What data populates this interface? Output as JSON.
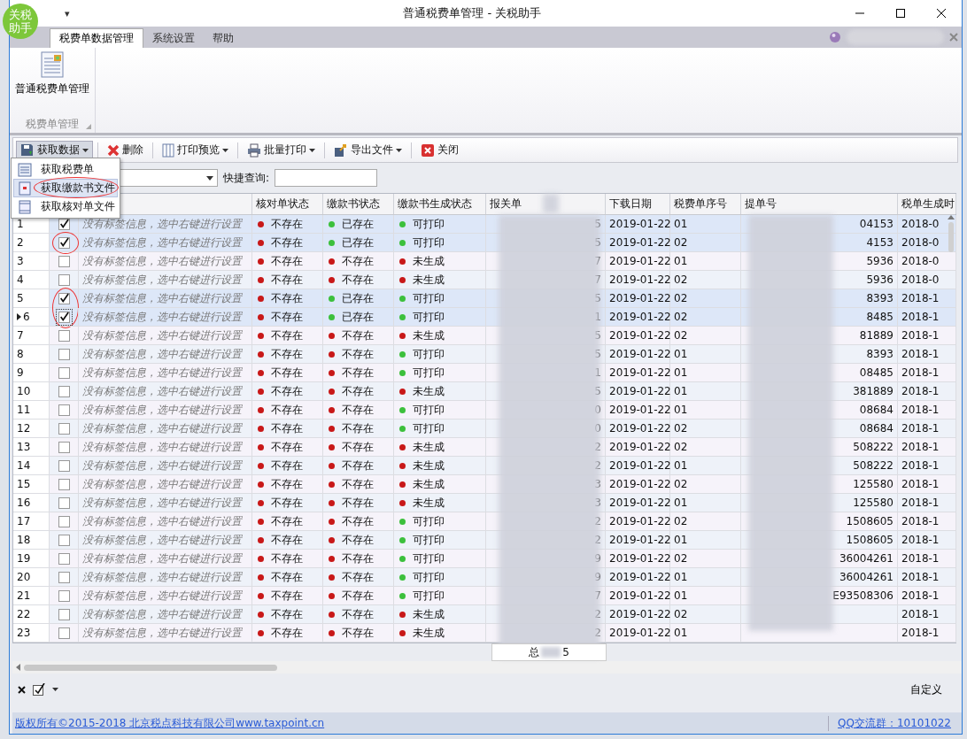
{
  "window": {
    "logo": [
      "关税",
      "助手"
    ],
    "quick_access": "▾",
    "title": "普通税费单管理 - 关税助手"
  },
  "ribbon": {
    "tabs": [
      {
        "label": "税费单数据管理",
        "selected": true
      },
      {
        "label": "系统设置",
        "selected": false
      },
      {
        "label": "帮助",
        "selected": false
      }
    ],
    "big_button": "普通税费单管理",
    "group_label": "税费单管理"
  },
  "toolbar": [
    {
      "kind": "get",
      "label": "获取数据",
      "menu": true,
      "pressed": true
    },
    {
      "kind": "delete",
      "label": "删除",
      "menu": false,
      "pressed": false
    },
    {
      "kind": "preview",
      "label": "打印预览",
      "menu": true,
      "pressed": false
    },
    {
      "kind": "print",
      "label": "批量打印",
      "menu": true,
      "pressed": false
    },
    {
      "kind": "export",
      "label": "导出文件",
      "menu": true,
      "pressed": false
    },
    {
      "kind": "close",
      "label": "关闭",
      "menu": false,
      "pressed": false
    }
  ],
  "dropdown": [
    {
      "kind": "list",
      "label": "获取税费单",
      "selected": false,
      "circled": false
    },
    {
      "kind": "doc",
      "label": "获取缴款书文件",
      "selected": true,
      "circled": true
    },
    {
      "kind": "form",
      "label": "获取核对单文件",
      "selected": false,
      "circled": false
    }
  ],
  "quick_search": {
    "label": "快捷查询:"
  },
  "table": {
    "columns": [
      "核对单状态",
      "缴款书状态",
      "缴款书生成状态",
      "报关单",
      "下载日期",
      "税费单序号",
      "提单号",
      "税单生成时"
    ],
    "rows": [
      {
        "no": "1",
        "checked": true,
        "circled": false,
        "current": false,
        "label": "没有标签信息，选中右键进行设置",
        "verify": {
          "text": "不存在",
          "ok": false
        },
        "payment": {
          "text": "已存在",
          "ok": true
        },
        "gen": {
          "text": "可打印",
          "ok": true
        },
        "customs": "5",
        "date": "2019-01-22",
        "seq": "01",
        "bill": "04153",
        "time": "2018-0"
      },
      {
        "no": "2",
        "checked": true,
        "circled": true,
        "current": false,
        "label": "没有标签信息，选中右键进行设置",
        "verify": {
          "text": "不存在",
          "ok": false
        },
        "payment": {
          "text": "已存在",
          "ok": true
        },
        "gen": {
          "text": "可打印",
          "ok": true
        },
        "customs": "5",
        "date": "2019-01-22",
        "seq": "02",
        "bill": "4153",
        "time": "2018-0"
      },
      {
        "no": "3",
        "checked": false,
        "circled": false,
        "current": false,
        "label": "没有标签信息，选中右键进行设置",
        "verify": {
          "text": "不存在",
          "ok": false
        },
        "payment": {
          "text": "不存在",
          "ok": false
        },
        "gen": {
          "text": "未生成",
          "ok": false
        },
        "customs": "7",
        "date": "2019-01-22",
        "seq": "01",
        "bill": "5936",
        "time": "2018-0"
      },
      {
        "no": "4",
        "checked": false,
        "circled": false,
        "current": false,
        "label": "没有标签信息，选中右键进行设置",
        "verify": {
          "text": "不存在",
          "ok": false
        },
        "payment": {
          "text": "不存在",
          "ok": false
        },
        "gen": {
          "text": "未生成",
          "ok": false
        },
        "customs": "7",
        "date": "2019-01-22",
        "seq": "02",
        "bill": "5936",
        "time": "2018-0"
      },
      {
        "no": "5",
        "checked": true,
        "circled": true,
        "current": false,
        "label": "没有标签信息，选中右键进行设置",
        "verify": {
          "text": "不存在",
          "ok": false
        },
        "payment": {
          "text": "已存在",
          "ok": true
        },
        "gen": {
          "text": "可打印",
          "ok": true
        },
        "customs": "5",
        "date": "2019-01-22",
        "seq": "02",
        "bill": "8393",
        "time": "2018-1"
      },
      {
        "no": "6",
        "checked": true,
        "circled": true,
        "current": true,
        "label": "没有标签信息，选中右键进行设置",
        "verify": {
          "text": "不存在",
          "ok": false
        },
        "payment": {
          "text": "已存在",
          "ok": true
        },
        "gen": {
          "text": "可打印",
          "ok": true
        },
        "customs": "1",
        "date": "2019-01-22",
        "seq": "02",
        "bill": "8485",
        "time": "2018-1"
      },
      {
        "no": "7",
        "checked": false,
        "circled": false,
        "current": false,
        "label": "没有标签信息，选中右键进行设置",
        "verify": {
          "text": "不存在",
          "ok": false
        },
        "payment": {
          "text": "不存在",
          "ok": false
        },
        "gen": {
          "text": "未生成",
          "ok": false
        },
        "customs": "5",
        "date": "2019-01-22",
        "seq": "02",
        "bill": "81889",
        "time": "2018-1"
      },
      {
        "no": "8",
        "checked": false,
        "circled": false,
        "current": false,
        "label": "没有标签信息，选中右键进行设置",
        "verify": {
          "text": "不存在",
          "ok": false
        },
        "payment": {
          "text": "不存在",
          "ok": false
        },
        "gen": {
          "text": "可打印",
          "ok": true
        },
        "customs": "5",
        "date": "2019-01-22",
        "seq": "01",
        "bill": "8393",
        "time": "2018-1"
      },
      {
        "no": "9",
        "checked": false,
        "circled": false,
        "current": false,
        "label": "没有标签信息，选中右键进行设置",
        "verify": {
          "text": "不存在",
          "ok": false
        },
        "payment": {
          "text": "不存在",
          "ok": false
        },
        "gen": {
          "text": "可打印",
          "ok": true
        },
        "customs": "1",
        "date": "2019-01-22",
        "seq": "01",
        "bill": "08485",
        "time": "2018-1"
      },
      {
        "no": "10",
        "checked": false,
        "circled": false,
        "current": false,
        "label": "没有标签信息，选中右键进行设置",
        "verify": {
          "text": "不存在",
          "ok": false
        },
        "payment": {
          "text": "不存在",
          "ok": false
        },
        "gen": {
          "text": "未生成",
          "ok": false
        },
        "customs": "5",
        "date": "2019-01-22",
        "seq": "01",
        "bill": "381889",
        "time": "2018-1"
      },
      {
        "no": "11",
        "checked": false,
        "circled": false,
        "current": false,
        "label": "没有标签信息，选中右键进行设置",
        "verify": {
          "text": "不存在",
          "ok": false
        },
        "payment": {
          "text": "不存在",
          "ok": false
        },
        "gen": {
          "text": "可打印",
          "ok": true
        },
        "customs": "0",
        "date": "2019-01-22",
        "seq": "01",
        "bill": "08684",
        "time": "2018-1"
      },
      {
        "no": "12",
        "checked": false,
        "circled": false,
        "current": false,
        "label": "没有标签信息，选中右键进行设置",
        "verify": {
          "text": "不存在",
          "ok": false
        },
        "payment": {
          "text": "不存在",
          "ok": false
        },
        "gen": {
          "text": "可打印",
          "ok": true
        },
        "customs": "0",
        "date": "2019-01-22",
        "seq": "02",
        "bill": "08684",
        "time": "2018-1"
      },
      {
        "no": "13",
        "checked": false,
        "circled": false,
        "current": false,
        "label": "没有标签信息，选中右键进行设置",
        "verify": {
          "text": "不存在",
          "ok": false
        },
        "payment": {
          "text": "不存在",
          "ok": false
        },
        "gen": {
          "text": "未生成",
          "ok": false
        },
        "customs": "2",
        "date": "2019-01-22",
        "seq": "02",
        "bill": "508222",
        "time": "2018-1"
      },
      {
        "no": "14",
        "checked": false,
        "circled": false,
        "current": false,
        "label": "没有标签信息，选中右键进行设置",
        "verify": {
          "text": "不存在",
          "ok": false
        },
        "payment": {
          "text": "不存在",
          "ok": false
        },
        "gen": {
          "text": "未生成",
          "ok": false
        },
        "customs": "2",
        "date": "2019-01-22",
        "seq": "01",
        "bill": "508222",
        "time": "2018-1"
      },
      {
        "no": "15",
        "checked": false,
        "circled": false,
        "current": false,
        "label": "没有标签信息，选中右键进行设置",
        "verify": {
          "text": "不存在",
          "ok": false
        },
        "payment": {
          "text": "不存在",
          "ok": false
        },
        "gen": {
          "text": "未生成",
          "ok": false
        },
        "customs": "3",
        "date": "2019-01-22",
        "seq": "02",
        "bill": "125580",
        "time": "2018-1"
      },
      {
        "no": "16",
        "checked": false,
        "circled": false,
        "current": false,
        "label": "没有标签信息，选中右键进行设置",
        "verify": {
          "text": "不存在",
          "ok": false
        },
        "payment": {
          "text": "不存在",
          "ok": false
        },
        "gen": {
          "text": "未生成",
          "ok": false
        },
        "customs": "3",
        "date": "2019-01-22",
        "seq": "01",
        "bill": "125580",
        "time": "2018-1"
      },
      {
        "no": "17",
        "checked": false,
        "circled": false,
        "current": false,
        "label": "没有标签信息，选中右键进行设置",
        "verify": {
          "text": "不存在",
          "ok": false
        },
        "payment": {
          "text": "不存在",
          "ok": false
        },
        "gen": {
          "text": "可打印",
          "ok": true
        },
        "customs": "2",
        "date": "2019-01-22",
        "seq": "02",
        "bill": "1508605",
        "time": "2018-1"
      },
      {
        "no": "18",
        "checked": false,
        "circled": false,
        "current": false,
        "label": "没有标签信息，选中右键进行设置",
        "verify": {
          "text": "不存在",
          "ok": false
        },
        "payment": {
          "text": "不存在",
          "ok": false
        },
        "gen": {
          "text": "可打印",
          "ok": true
        },
        "customs": "2",
        "date": "2019-01-22",
        "seq": "01",
        "bill": "1508605",
        "time": "2018-1"
      },
      {
        "no": "19",
        "checked": false,
        "circled": false,
        "current": false,
        "label": "没有标签信息，选中右键进行设置",
        "verify": {
          "text": "不存在",
          "ok": false
        },
        "payment": {
          "text": "不存在",
          "ok": false
        },
        "gen": {
          "text": "可打印",
          "ok": true
        },
        "customs": "9",
        "date": "2019-01-22",
        "seq": "02",
        "bill": "36004261",
        "time": "2018-1"
      },
      {
        "no": "20",
        "checked": false,
        "circled": false,
        "current": false,
        "label": "没有标签信息，选中右键进行设置",
        "verify": {
          "text": "不存在",
          "ok": false
        },
        "payment": {
          "text": "不存在",
          "ok": false
        },
        "gen": {
          "text": "可打印",
          "ok": true
        },
        "customs": "9",
        "date": "2019-01-22",
        "seq": "01",
        "bill": "36004261",
        "time": "2018-1"
      },
      {
        "no": "21",
        "checked": false,
        "circled": false,
        "current": false,
        "label": "没有标签信息，选中右键进行设置",
        "verify": {
          "text": "不存在",
          "ok": false
        },
        "payment": {
          "text": "不存在",
          "ok": false
        },
        "gen": {
          "text": "可打印",
          "ok": true
        },
        "customs": "7",
        "date": "2019-01-22",
        "seq": "01",
        "bill": "E93508306",
        "time": "2018-1"
      },
      {
        "no": "22",
        "checked": false,
        "circled": false,
        "current": false,
        "label": "没有标签信息，选中右键进行设置",
        "verify": {
          "text": "不存在",
          "ok": false
        },
        "payment": {
          "text": "不存在",
          "ok": false
        },
        "gen": {
          "text": "未生成",
          "ok": false
        },
        "customs": "2",
        "date": "2019-01-22",
        "seq": "02",
        "time": "2018-1"
      },
      {
        "no": "23",
        "checked": false,
        "circled": false,
        "current": false,
        "label": "没有标签信息，选中右键进行设置",
        "verify": {
          "text": "不存在",
          "ok": false
        },
        "payment": {
          "text": "不存在",
          "ok": false
        },
        "gen": {
          "text": "未生成",
          "ok": false
        },
        "customs": "2",
        "date": "2019-01-22",
        "seq": "01",
        "time": "2018-1"
      }
    ],
    "total": {
      "label": "总",
      "tail": "5"
    }
  },
  "filter_bar": {
    "customize": "自定义"
  },
  "status_bar": {
    "copyright": "版权所有©2015-2018 北京税点科技有限公司www.taxpoint.cn",
    "qq": "QQ交流群：10101022"
  }
}
